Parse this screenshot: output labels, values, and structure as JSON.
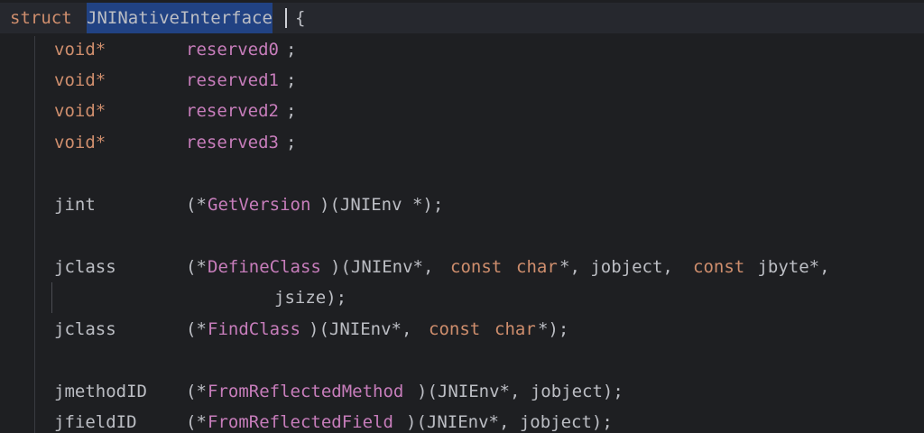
{
  "editor": {
    "colors": {
      "background": "#1e1f22",
      "current_line": "#26282e",
      "keyword": "#cf8e6d",
      "member": "#c77dbb",
      "default_text": "#bcbec4",
      "selection": "#214283"
    },
    "selected_text": "JNINativeInterface",
    "lines": {
      "l1": {
        "kw": "struct",
        "name": "JNINativeInterface",
        "brace": "{"
      },
      "l2": {
        "type": "void*",
        "field": "reserved0",
        "end": ";"
      },
      "l3": {
        "type": "void*",
        "field": "reserved1",
        "end": ";"
      },
      "l4": {
        "type": "void*",
        "field": "reserved2",
        "end": ";"
      },
      "l5": {
        "type": "void*",
        "field": "reserved3",
        "end": ";"
      },
      "l7": {
        "type": "jint",
        "open": "(*",
        "fn": "GetVersion",
        "rest": ")(JNIEnv *);"
      },
      "l9": {
        "type": "jclass",
        "open": "(*",
        "fn": "DefineClass",
        "p1": ")(JNIEnv*, ",
        "kw1": "const",
        "sp1": " ",
        "kw2": "char",
        "p2": "*, jobject, ",
        "kw3": "const",
        "p3": " jbyte*,"
      },
      "l10": {
        "cont": "jsize);"
      },
      "l11": {
        "type": "jclass",
        "open": "(*",
        "fn": "FindClass",
        "p1": ")(JNIEnv*, ",
        "kw1": "const",
        "sp1": " ",
        "kw2": "char",
        "p2": "*);"
      },
      "l13": {
        "type": "jmethodID",
        "open": "(*",
        "fn": "FromReflectedMethod",
        "rest": ")(JNIEnv*, jobject);"
      },
      "l14": {
        "type": "jfieldID",
        "open": "(*",
        "fn": "FromReflectedField",
        "rest": ")(JNIEnv*, jobject);"
      }
    }
  }
}
